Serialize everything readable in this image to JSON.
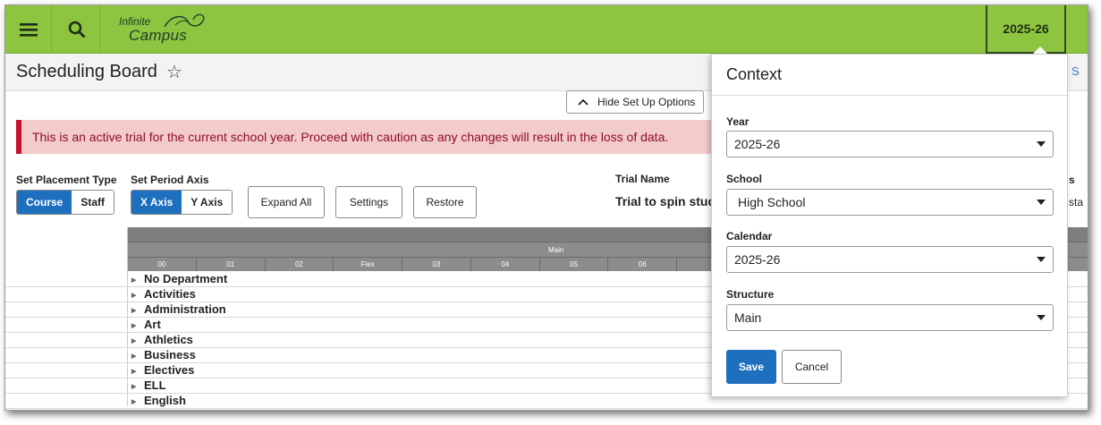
{
  "topbar": {
    "menu_icon": "hamburger-icon",
    "search_icon": "search-icon",
    "logo_line1": "Infinite",
    "logo_line2": "Campus",
    "year_button": "2025-26"
  },
  "page": {
    "title": "Scheduling Board",
    "favorite_icon": "star-icon",
    "hide_setup_label": "Hide Set Up Options",
    "banner_text": "This is an active trial for the current school year. Proceed with caution as any changes will result in the loss of data.",
    "placement_label": "Set Placement Type",
    "placement_options": [
      "Course",
      "Staff"
    ],
    "period_axis_label": "Set Period Axis",
    "period_axis_options": [
      "X Axis",
      "Y Axis"
    ],
    "expand_all": "Expand All",
    "settings": "Settings",
    "restore": "Restore",
    "trial_name_label": "Trial Name",
    "trial_name_value": "Trial to spin stud",
    "right_edge_s": "S",
    "right_edge_label": "s",
    "right_edge_value": "sta"
  },
  "grid": {
    "structure_header": "Main",
    "periods": [
      "00",
      "01",
      "02",
      "Flex",
      "03",
      "04",
      "05",
      "06"
    ],
    "departments": [
      "No Department",
      "Activities",
      "Administration",
      "Art",
      "Athletics",
      "Business",
      "Electives",
      "ELL",
      "English"
    ]
  },
  "context": {
    "title": "Context",
    "year_label": "Year",
    "year_value": "2025-26",
    "school_label": "School",
    "school_value": "High School",
    "calendar_label": "Calendar",
    "calendar_value": "2025-26",
    "structure_label": "Structure",
    "structure_value": "Main",
    "save": "Save",
    "cancel": "Cancel"
  },
  "colors": {
    "topbar": "#8dc541",
    "primary": "#1f6fbf",
    "banner_bg": "#f4cbcb",
    "banner_accent": "#c8102e"
  }
}
